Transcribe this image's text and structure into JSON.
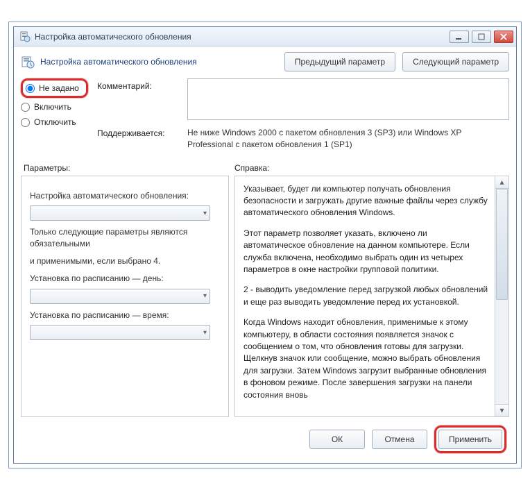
{
  "window": {
    "title": "Настройка автоматического обновления",
    "header": "Настройка автоматического обновления"
  },
  "nav": {
    "prev": "Предыдущий параметр",
    "next": "Следующий параметр"
  },
  "radios": {
    "not_set": "Не задано",
    "enable": "Включить",
    "disable": "Отключить"
  },
  "fields": {
    "comment_label": "Комментарий:",
    "comment_value": "",
    "supported_label": "Поддерживается:",
    "supported_value": "Не ниже Windows 2000 с пакетом обновления 3 (SP3) или Windows XP Professional с пакетом обновления 1 (SP1)"
  },
  "sections": {
    "params": "Параметры:",
    "help": "Справка:"
  },
  "params": {
    "p1": "Настройка автоматического обновления:",
    "p2": "Только следующие параметры являются обязательными",
    "p3": "и применимыми, если выбрано 4.",
    "p4": "Установка по расписанию — день:",
    "p5": "Установка по расписанию — время:"
  },
  "help": {
    "t1": "Указывает, будет ли компьютер получать обновления безопасности и загружать другие важные файлы через службу автоматического обновления Windows.",
    "t2": "Этот параметр позволяет указать, включено ли автоматическое обновление на данном компьютере. Если служба включена, необходимо выбрать один из четырех параметров в окне настройки групповой политики.",
    "t3": "2 - выводить уведомление перед загрузкой любых обновлений и еще раз выводить уведомление перед их установкой.",
    "t4": "Когда Windows находит обновления, применимые к этому компьютеру, в области состояния появляется значок с сообщением о том, что обновления готовы для загрузки. Щелкнув значок или сообщение, можно выбрать обновления для загрузки. Затем Windows загрузит выбранные обновления в фоновом режиме. После завершения загрузки на панели состояния вновь"
  },
  "footer": {
    "ok": "ОК",
    "cancel": "Отмена",
    "apply": "Применить"
  }
}
